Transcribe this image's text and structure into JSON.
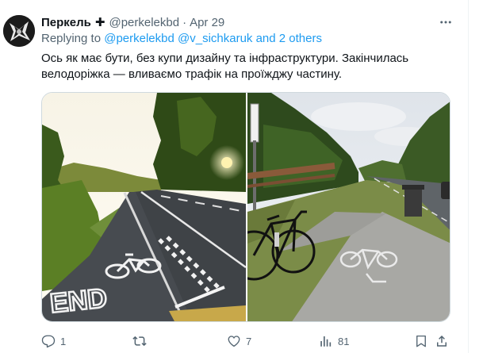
{
  "tweet": {
    "author": {
      "display_name": "Перкель",
      "badge_glyph": "✚",
      "handle": "@perkelekbd",
      "separator": "·",
      "date": "Apr 29"
    },
    "reply": {
      "prefix": "Replying to",
      "mentions": "@perkelekbd @v_sichkaruk and 2 others"
    },
    "text_lines": [
      "Ось як має бути, без купи дизайну та інфраструктури. Закінчилась",
      "велодоріжка — вливаємо трафік на проїжджу частину."
    ],
    "media": [
      {
        "icon": "photo",
        "description_icon": "road-end-bike-lane-photo",
        "painted_text": "END"
      },
      {
        "icon": "photo",
        "description_icon": "bike-path-with-bicycle-photo"
      }
    ],
    "actions": {
      "replies": "1",
      "retweets": "",
      "likes": "7",
      "views": "81"
    },
    "icons": {
      "more": "more-horizontal-icon",
      "reply": "reply-icon",
      "retweet": "retweet-icon",
      "like": "heart-icon",
      "views": "views-icon",
      "bookmark": "bookmark-icon",
      "share": "share-icon"
    },
    "colors": {
      "text": "#0f1419",
      "secondary": "#536471",
      "link": "#1d9bf0",
      "border": "#cfd9de"
    }
  }
}
